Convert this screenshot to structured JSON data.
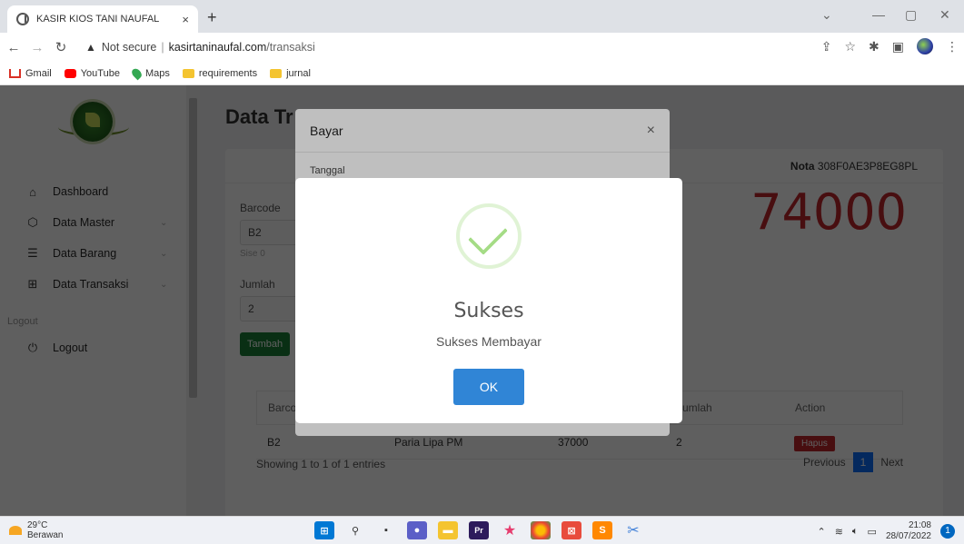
{
  "browser": {
    "tab_title": "KASIR KIOS TANI NAUFAL",
    "tab_close": "×",
    "new_tab": "+",
    "security_label": "Not secure",
    "url_host": "kasirtaninaufal.com",
    "url_path": "/transaksi",
    "bookmarks": [
      "Gmail",
      "YouTube",
      "Maps",
      "requirements",
      "jurnal"
    ]
  },
  "sidebar": {
    "items": [
      {
        "label": "Dashboard",
        "icon": "home-icon"
      },
      {
        "label": "Data Master",
        "icon": "cube-icon"
      },
      {
        "label": "Data Barang",
        "icon": "list-icon"
      },
      {
        "label": "Data Transaksi",
        "icon": "grid-icon"
      }
    ],
    "section": "Logout",
    "logout": "Logout"
  },
  "main": {
    "title": "Data Tr",
    "nota_label": "Nota",
    "nota_value": "308F0AE3P8EG8PL",
    "total": "74000",
    "barcode_label": "Barcode",
    "barcode_value": "B2",
    "stock_hint": "Sise 0",
    "jumlah_label": "Jumlah",
    "jumlah_value": "2",
    "tambah": "Tambah",
    "table": {
      "headers": [
        "Barco",
        "",
        "",
        "Jumlah",
        "Action"
      ],
      "rows": [
        {
          "barcode": "B2",
          "nama": "Paria Lipa PM",
          "harga": "37000",
          "jumlah": "2",
          "action": "Hapus"
        }
      ]
    },
    "showing": "Showing 1 to 1 of 1 entries",
    "pager": {
      "prev": "Previous",
      "page": "1",
      "next": "Next"
    }
  },
  "modal_bayar": {
    "title": "Bayar",
    "close": "×",
    "tanggal_label": "Tanggal"
  },
  "alert": {
    "title": "Sukses",
    "text": "Sukses Membayar",
    "ok": "OK"
  },
  "taskbar": {
    "temp": "29°C",
    "weather": "Berawan",
    "time": "21:08",
    "date": "28/07/2022",
    "notifications": "1"
  },
  "colors": {
    "total_red": "#c0272d",
    "ok_blue": "#3085d6",
    "success_green": "#a5dc86"
  }
}
